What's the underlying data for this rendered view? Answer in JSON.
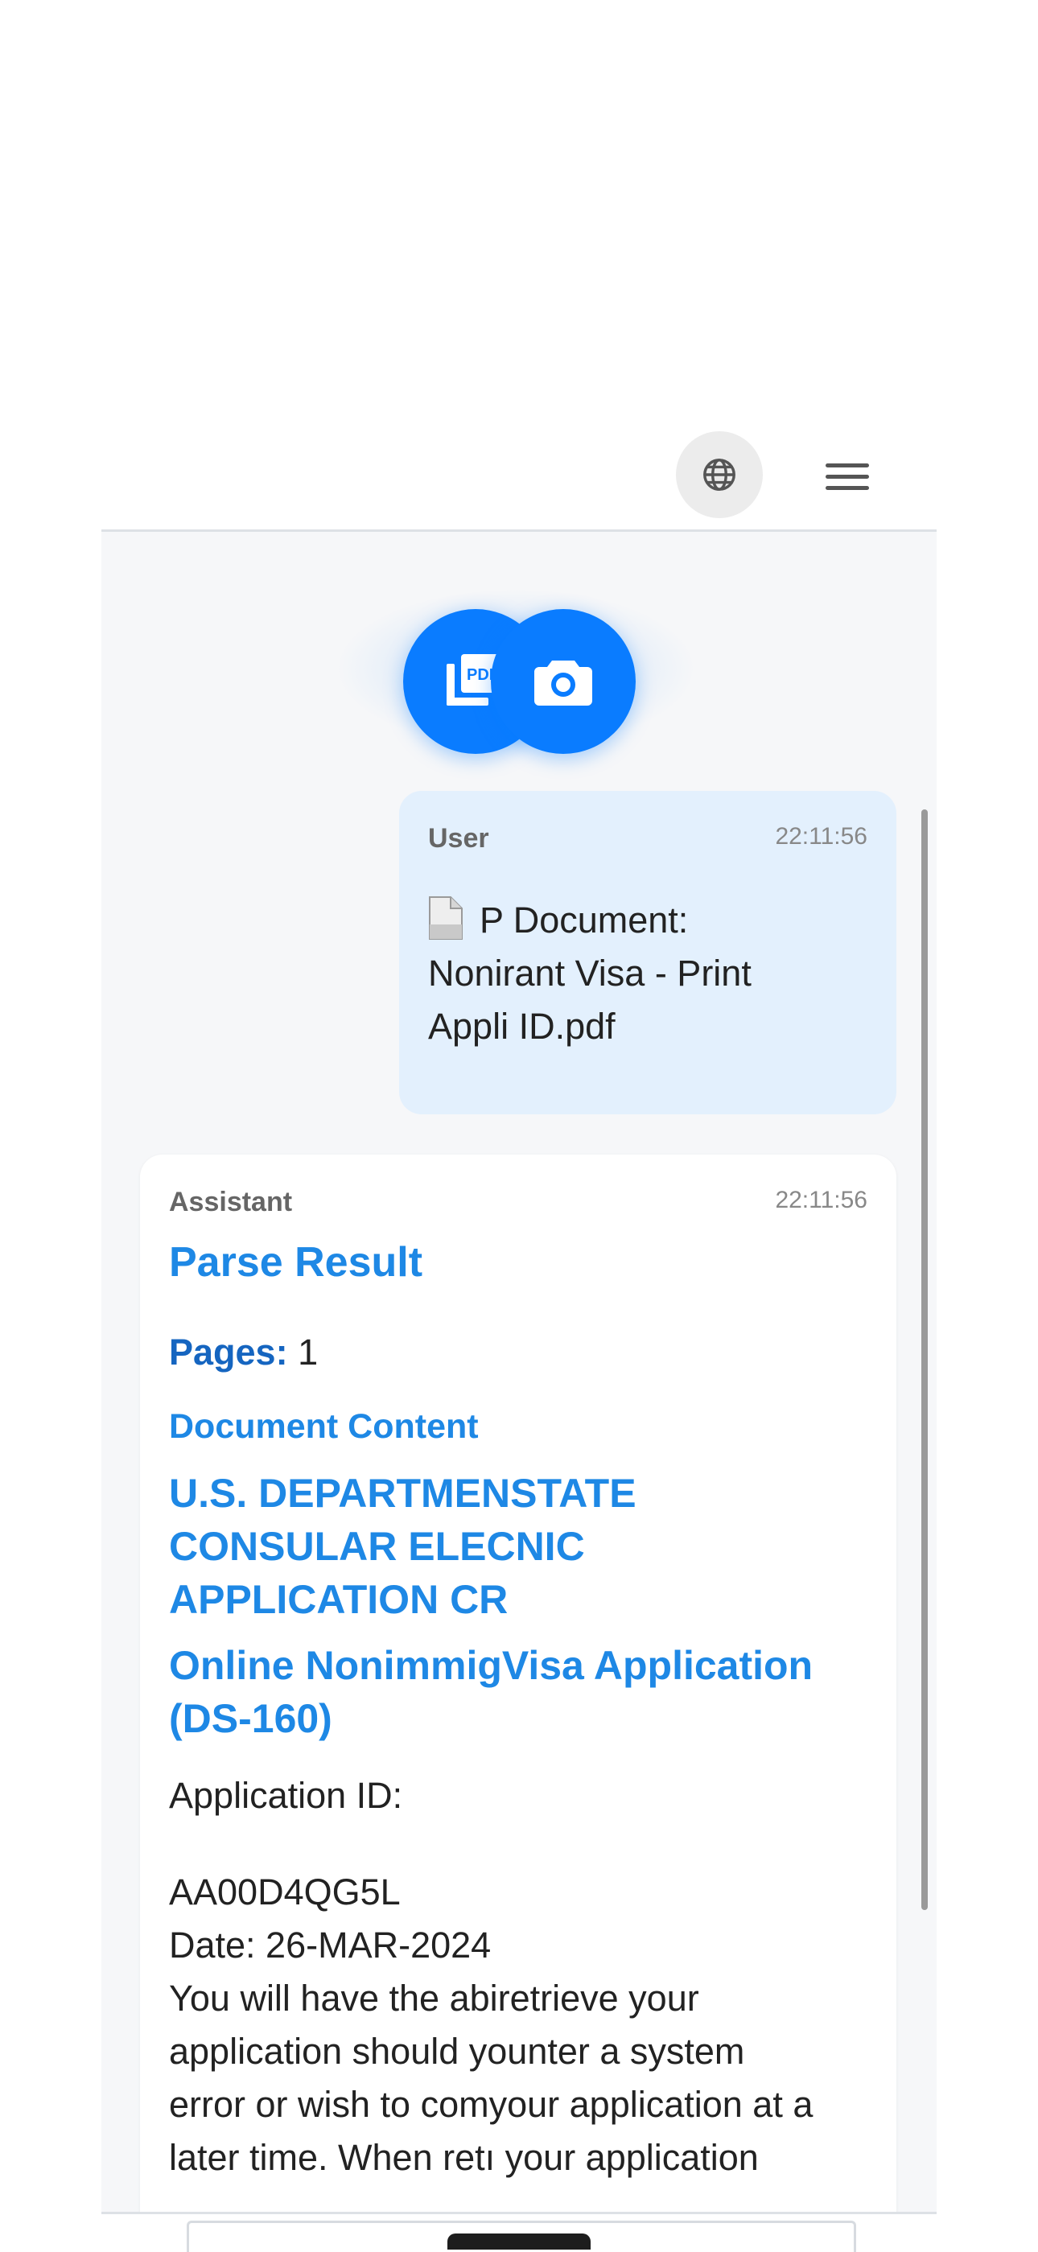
{
  "header": {
    "language_icon": "globe-icon",
    "menu_icon": "hamburger-menu-icon"
  },
  "upload": {
    "pdf_icon": "pdf-icon",
    "camera_icon": "camera-icon",
    "accent_color": "#0a7cff"
  },
  "messages": {
    "user": {
      "sender": "User",
      "time": "22:11:56",
      "file_icon": "document-icon",
      "line1": "P Document:",
      "line2": "Nonirant Visa - Print",
      "line3": "Appli ID.pdf"
    },
    "assistant": {
      "sender": "Assistant",
      "time": "22:11:56",
      "title": "Parse Result",
      "pages_label": "Pages:",
      "pages_value": "1",
      "section_title": "Document Content",
      "heading1": [
        "U.S. DEPARTMENSTATE",
        "CONSULAR ELECNIC",
        "APPLICATION CR"
      ],
      "heading2": [
        "Online NonimmigVisa Application",
        "(DS-160)"
      ],
      "application_id_label": "Application ID:",
      "application_id": "AA00D4QG5L",
      "date": "Date: 26-MAR-2024",
      "paragraph": [
        "You will have the abiretrieve your",
        "application should younter a system",
        "error or wish to comyour application at a",
        "later time. When retı your application"
      ]
    }
  }
}
